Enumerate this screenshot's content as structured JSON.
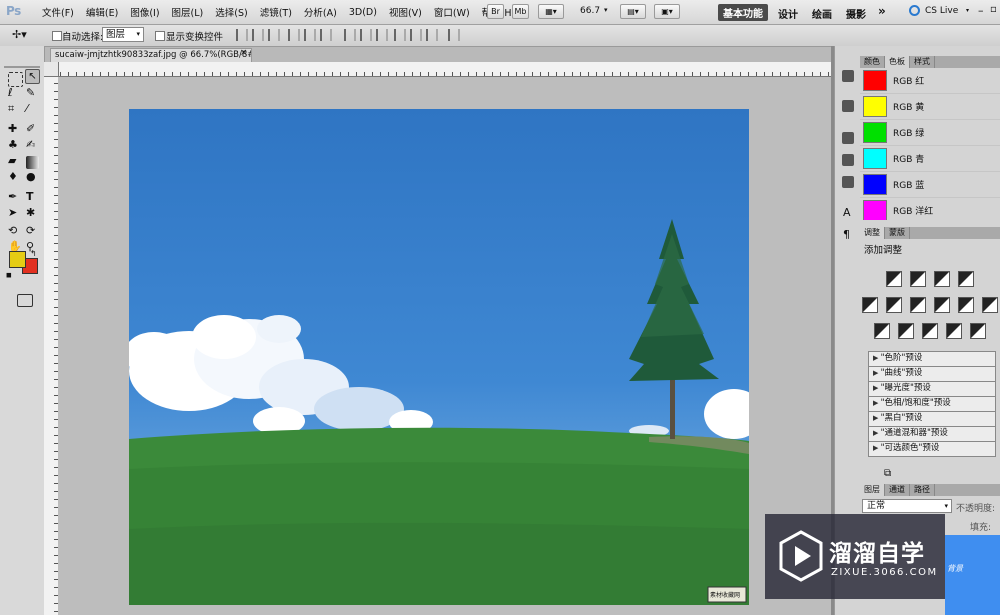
{
  "menubar": {
    "logo": "Ps",
    "menus": [
      "文件(F)",
      "编辑(E)",
      "图像(I)",
      "图层(L)",
      "选择(S)",
      "滤镜(T)",
      "分析(A)",
      "3D(D)",
      "视图(V)",
      "窗口(W)",
      "帮助(H)"
    ],
    "zoom": "66.7",
    "br": "Br",
    "mb": "Mb",
    "workspaces": {
      "active": "基本功能",
      "design": "设计",
      "paint": "绘画",
      "photo": "摄影",
      "more": "»"
    },
    "cslive": "CS Live"
  },
  "options": {
    "auto_select_label": "自动选择:",
    "layer_option": "图层",
    "show_transform_label": "显示变换控件"
  },
  "document": {
    "tab_title": "sucaiw-jmjtzhtk90833zaf.jpg @ 66.7%(RGB/8#)",
    "close": "×"
  },
  "photo_badge": "素材收藏网",
  "panels": {
    "color_tabs": [
      "颜色",
      "色板",
      "样式"
    ],
    "swatches": [
      {
        "label": "RGB 红",
        "color": "#ff0000"
      },
      {
        "label": "RGB 黄",
        "color": "#ffff00"
      },
      {
        "label": "RGB 绿",
        "color": "#00e000"
      },
      {
        "label": "RGB 青",
        "color": "#00ffff"
      },
      {
        "label": "RGB 蓝",
        "color": "#0000ff"
      },
      {
        "label": "RGB 洋红",
        "color": "#ff00ff"
      }
    ],
    "adj_tabs": [
      "调整",
      "蒙版"
    ],
    "adj_title": "添加调整",
    "presets": [
      "\"色阶\"预设",
      "\"曲线\"预设",
      "\"曝光度\"预设",
      "\"色相/饱和度\"预设",
      "\"黑白\"预设",
      "\"通道混和器\"预设",
      "\"可选颜色\"预设"
    ],
    "layer_tabs": [
      "图层",
      "通道",
      "路径"
    ],
    "blend_mode": "正常",
    "opacity_label": "不透明度:",
    "fill_label": "填充:",
    "layer_name": "背景"
  },
  "watermark": {
    "title": "溜溜自学",
    "subtitle": "ZIXUE.3066.COM"
  },
  "colors": {
    "foreground": "#e5cc14",
    "background": "#e23020"
  }
}
